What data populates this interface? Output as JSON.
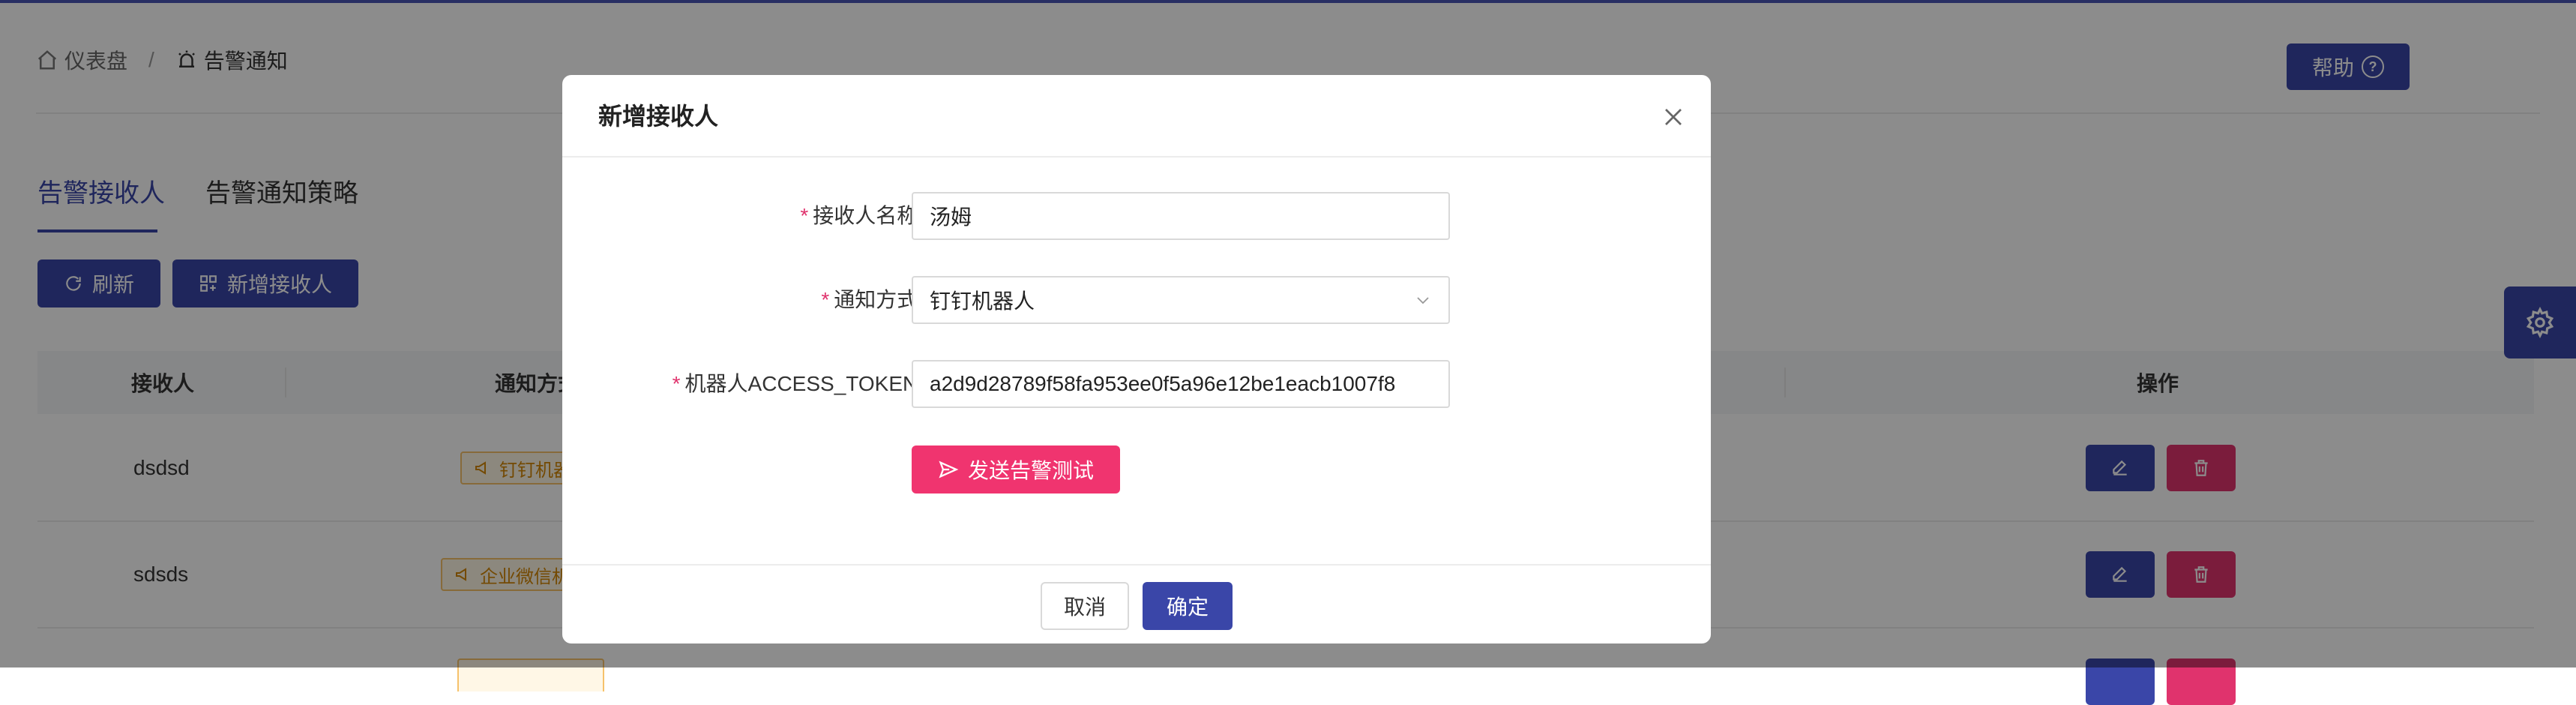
{
  "breadcrumb": {
    "home_label": "仪表盘",
    "separator": "/",
    "current_label": "告警通知"
  },
  "header": {
    "help_label": "帮助"
  },
  "tabs": [
    {
      "label": "告警接收人",
      "active": true
    },
    {
      "label": "告警通知策略",
      "active": false
    }
  ],
  "toolbar": {
    "refresh_label": "刷新",
    "add_label": "新增接收人"
  },
  "table": {
    "columns": [
      "接收人",
      "通知方式",
      "操作"
    ],
    "rows": [
      {
        "name": "dsdsd",
        "notify": "钉钉机器人"
      },
      {
        "name": "sdsds",
        "notify": "企业微信机器人"
      }
    ]
  },
  "modal": {
    "title": "新增接收人",
    "fields": [
      {
        "label": "接收人名称:",
        "value": "汤姆",
        "required": true
      },
      {
        "label": "通知方式:",
        "value": "钉钉机器人",
        "required": true
      },
      {
        "label": "机器人ACCESS_TOKEN:",
        "value": "a2d9d28789f58fa953ee0f5a96e12be1eacb1007f8",
        "required": true
      }
    ],
    "required_mark": "*",
    "test_button_label": "发送告警测试",
    "cancel_label": "取消",
    "ok_label": "确定"
  },
  "colors": {
    "primary": "#3a46a8",
    "danger": "#e0336d",
    "test_button": "#f0346f",
    "tag_border": "#f6c26b",
    "tag_text": "#d48806"
  }
}
